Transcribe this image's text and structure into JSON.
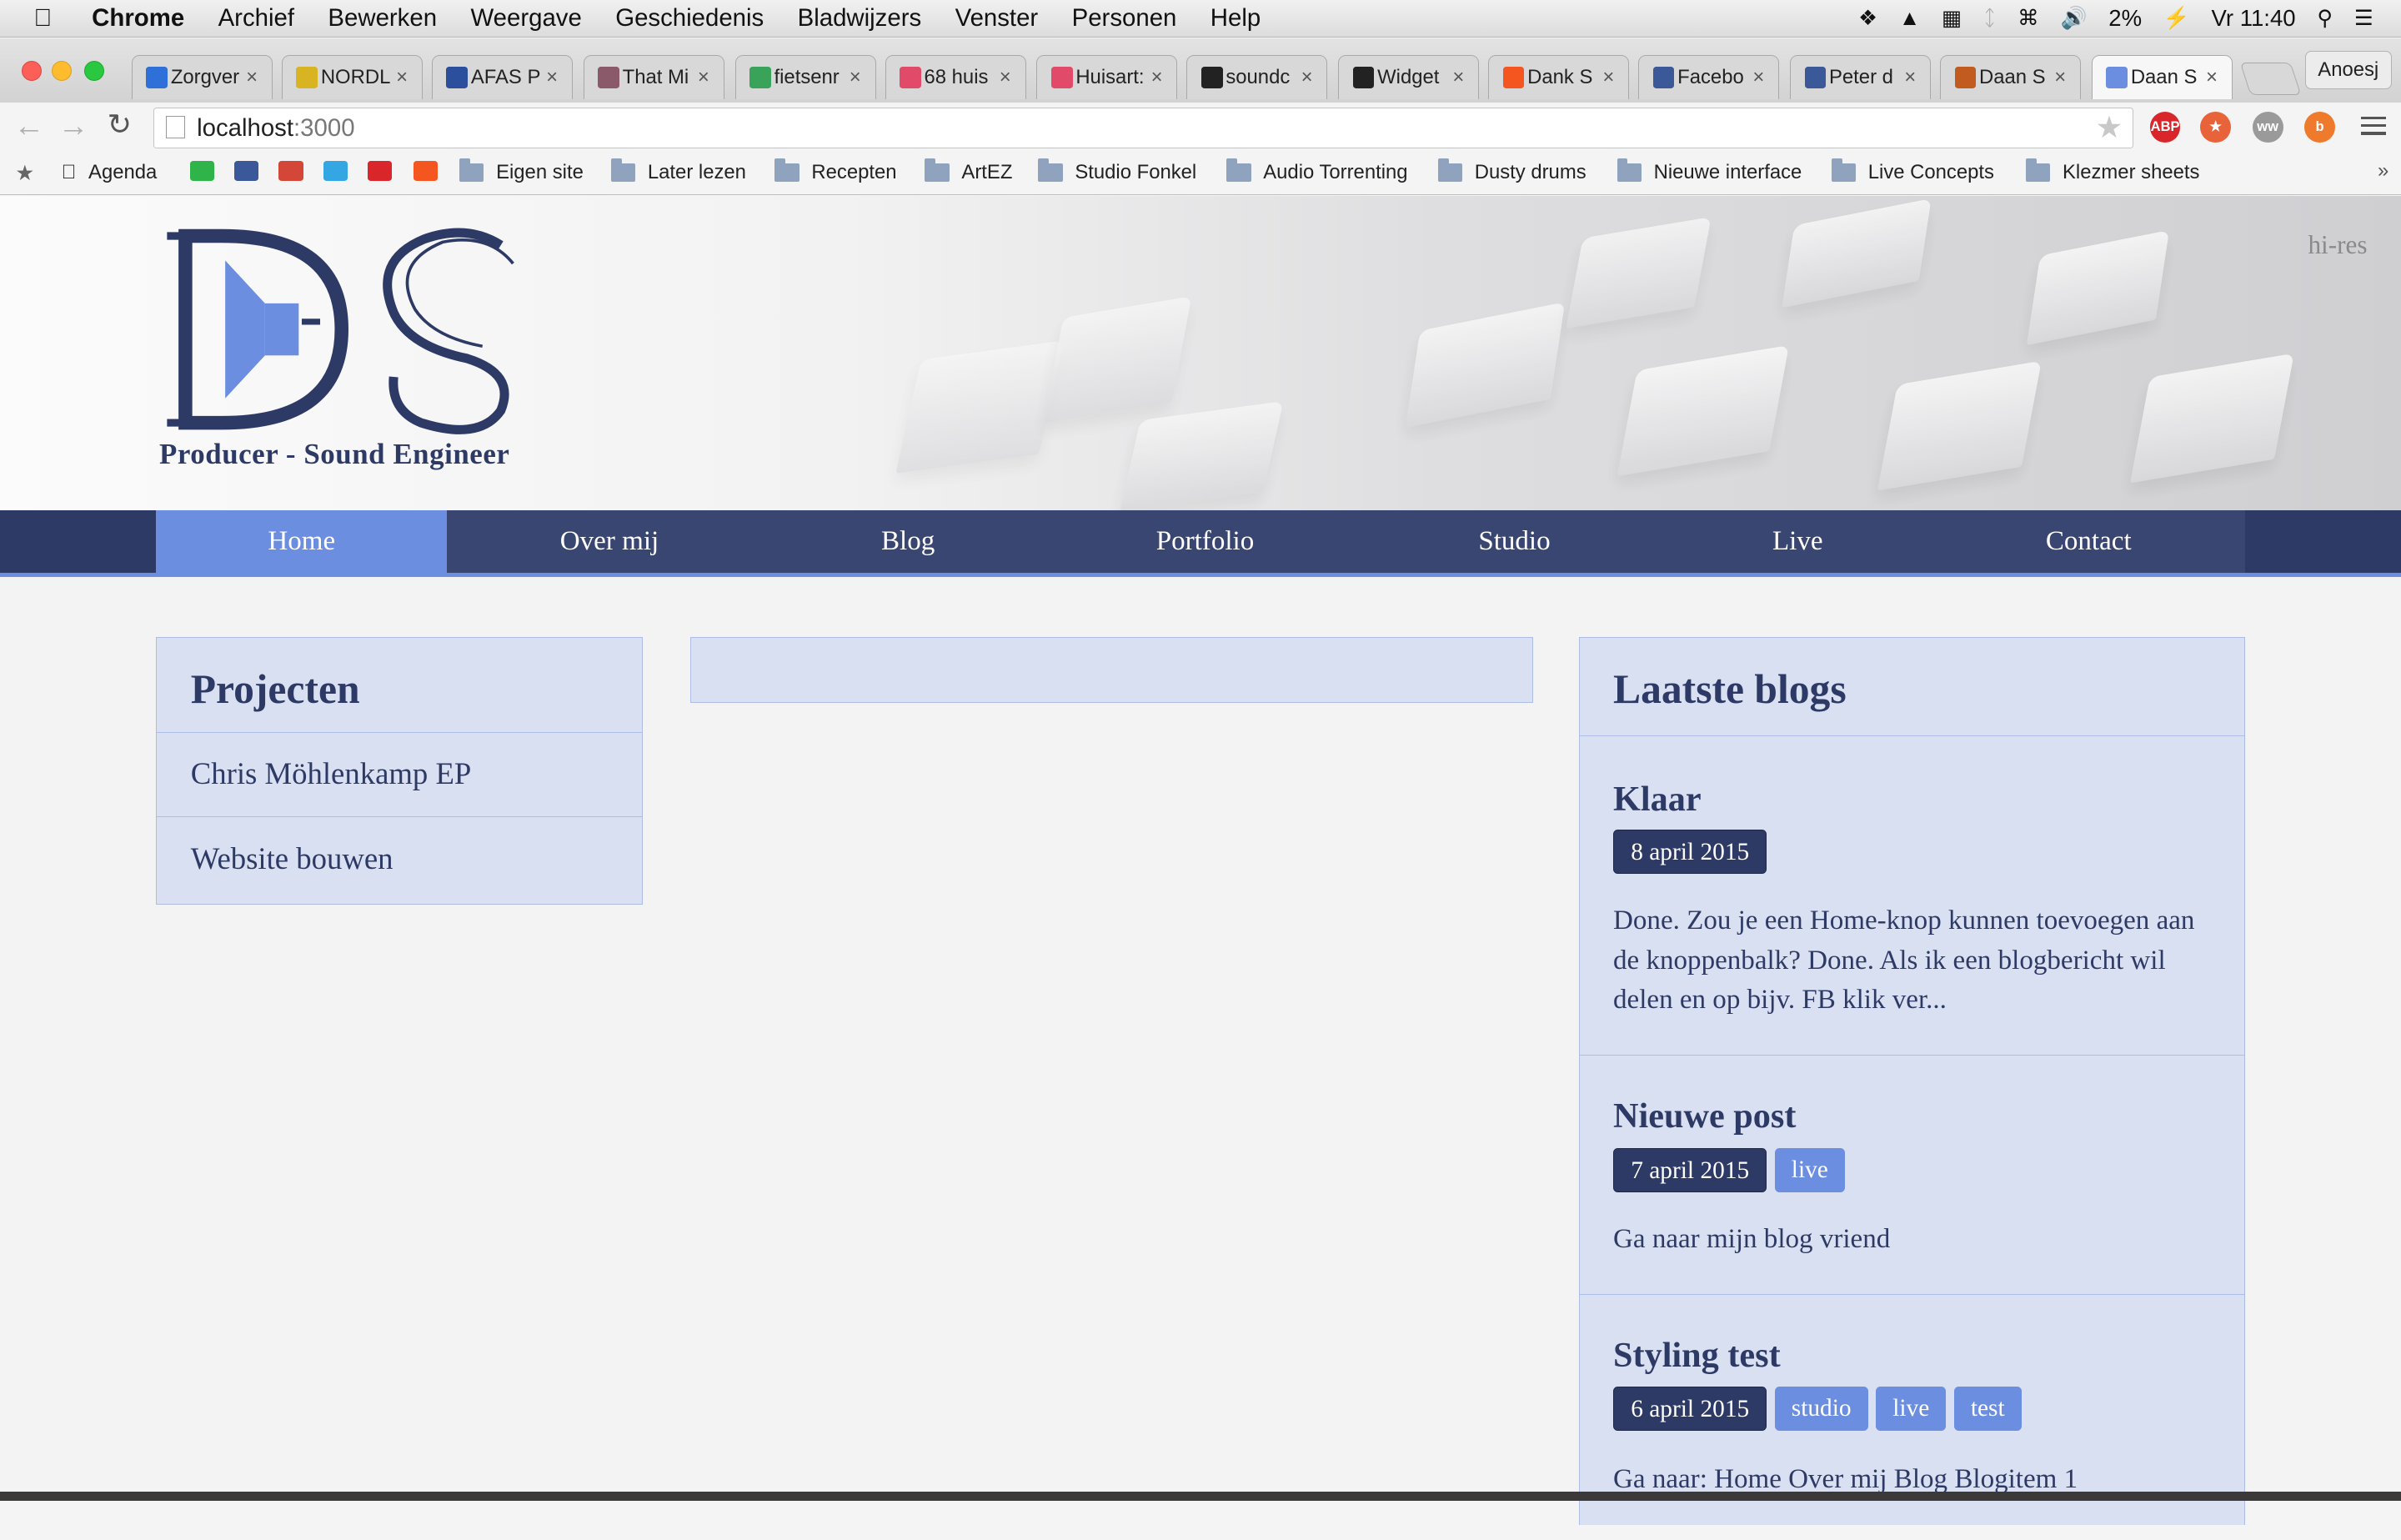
{
  "menubar": {
    "app": "Chrome",
    "items": [
      "Archief",
      "Bewerken",
      "Weergave",
      "Geschiedenis",
      "Bladwijzers",
      "Venster",
      "Personen",
      "Help"
    ],
    "battery": "2%",
    "clock": "Vr 11:40"
  },
  "tabs": [
    {
      "label": "Zorgver",
      "icon": "cross-icon",
      "color": "#2f6fd8"
    },
    {
      "label": "NORDL",
      "icon": "nordl-icon",
      "color": "#d8b422"
    },
    {
      "label": "AFAS P",
      "icon": "afas-icon",
      "color": "#2b4f9c"
    },
    {
      "label": "That Mi",
      "icon": "image-icon",
      "color": "#8a5a6a"
    },
    {
      "label": "fietsenr",
      "icon": "maps-icon",
      "color": "#3aa35a"
    },
    {
      "label": "68 huis",
      "icon": "cross-icon",
      "color": "#e24a6a"
    },
    {
      "label": "Huisart:",
      "icon": "cross-icon",
      "color": "#e24a6a"
    },
    {
      "label": "soundc",
      "icon": "github-icon",
      "color": "#222222"
    },
    {
      "label": "Widget",
      "icon": "github-icon",
      "color": "#222222"
    },
    {
      "label": "Dank S",
      "icon": "soundcloud-icon",
      "color": "#f5561f"
    },
    {
      "label": "Facebo",
      "icon": "facebook-icon",
      "color": "#3b5998"
    },
    {
      "label": "Peter d",
      "icon": "facebook-icon",
      "color": "#3b5998"
    },
    {
      "label": "Daan S",
      "icon": "star-icon",
      "color": "#c25b1f"
    },
    {
      "label": "Daan S",
      "icon": "ds-icon",
      "color": "#6b8ee0",
      "active": true
    }
  ],
  "profile": "Anoesj",
  "address": {
    "host": "localhost",
    "port": ":3000"
  },
  "extensions": [
    {
      "label": "ABP",
      "color": "#d8262b"
    },
    {
      "label": "★",
      "color": "#e8623a"
    },
    {
      "label": "ww",
      "color": "#9a9a9a"
    },
    {
      "label": "b",
      "color": "#f07a2b"
    }
  ],
  "bookmarks": [
    {
      "label": "",
      "type": "star"
    },
    {
      "label": "Agenda",
      "type": "apple"
    },
    {
      "label": "",
      "type": "whatsapp",
      "color": "#2fb44a"
    },
    {
      "label": "",
      "type": "facebook",
      "color": "#3b5998"
    },
    {
      "label": "",
      "type": "gmail",
      "color": "#d44638"
    },
    {
      "label": "",
      "type": "twitter",
      "color": "#34a7e2"
    },
    {
      "label": "",
      "type": "youtube",
      "color": "#d8262b"
    },
    {
      "label": "",
      "type": "soundcloud",
      "color": "#f5561f"
    },
    {
      "label": "Eigen site",
      "type": "folder"
    },
    {
      "label": "Later lezen",
      "type": "folder"
    },
    {
      "label": "Recepten",
      "type": "folder"
    },
    {
      "label": "ArtEZ",
      "type": "folder"
    },
    {
      "label": "Studio Fonkel",
      "type": "folder"
    },
    {
      "label": "Audio Torrenting",
      "type": "folder"
    },
    {
      "label": "Dusty drums",
      "type": "folder"
    },
    {
      "label": "Nieuwe interface",
      "type": "folder"
    },
    {
      "label": "Live Concepts",
      "type": "folder"
    },
    {
      "label": "Klezmer sheets",
      "type": "folder"
    }
  ],
  "site": {
    "hires_label": "hi-res",
    "logo_letters": "DS",
    "tagline": "Producer - Sound Engineer",
    "nav": [
      "Home",
      "Over mij",
      "Blog",
      "Portfolio",
      "Studio",
      "Live",
      "Contact"
    ],
    "nav_active": "Home",
    "projects": {
      "title": "Projecten",
      "items": [
        "Chris Möhlenkamp EP",
        "Website bouwen"
      ]
    },
    "blogs": {
      "title": "Laatste blogs",
      "posts": [
        {
          "title": "Klaar",
          "date": "8 april 2015",
          "tags": [],
          "excerpt": "Done. Zou je een Home-knop kunnen toevoegen aan de knoppenbalk? Done. Als ik een blogbericht wil delen en op bijv. FB klik ver..."
        },
        {
          "title": "Nieuwe post",
          "date": "7 april 2015",
          "tags": [
            "live"
          ],
          "excerpt": "Ga naar mijn blog vriend"
        },
        {
          "title": "Styling test",
          "date": "6 april 2015",
          "tags": [
            "studio",
            "live",
            "test"
          ],
          "excerpt": "Ga naar: Home Over mij Blog Blogitem 1"
        }
      ]
    }
  },
  "colors": {
    "navy": "#2e3a66",
    "accent": "#6b8ee0",
    "panel": "#d9e0f1"
  }
}
